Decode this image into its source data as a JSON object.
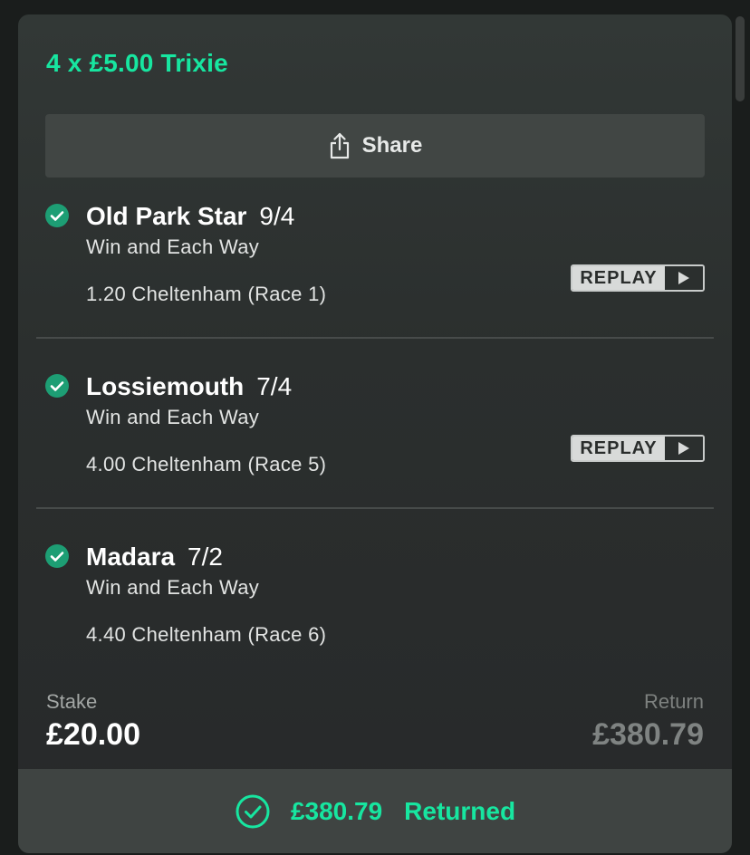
{
  "bet": {
    "title": "4 x £5.00 Trixie",
    "share_label": "Share"
  },
  "selections": [
    {
      "name": "Old Park Star",
      "odds": "9/4",
      "market": "Win and Each Way",
      "event": "1.20 Cheltenham (Race 1)",
      "replay": "REPLAY",
      "status": "won"
    },
    {
      "name": "Lossiemouth",
      "odds": "7/4",
      "market": "Win and Each Way",
      "event": "4.00 Cheltenham (Race 5)",
      "replay": "REPLAY",
      "status": "won"
    },
    {
      "name": "Madara",
      "odds": "7/2",
      "market": "Win and Each Way",
      "event": "4.40 Cheltenham (Race 6)",
      "status": "won"
    }
  ],
  "totals": {
    "stake_label": "Stake",
    "stake_value": "£20.00",
    "return_label": "Return",
    "return_value": "£380.79"
  },
  "footer": {
    "amount": "£380.79",
    "status_label": "Returned"
  },
  "colors": {
    "accent": "#17e6a0",
    "check": "#1d9e74",
    "background": "#2b2f2e"
  },
  "icons": {
    "share": "share-icon",
    "check": "check-circle-icon",
    "play": "play-icon",
    "returned": "check-circle-outline-icon"
  }
}
